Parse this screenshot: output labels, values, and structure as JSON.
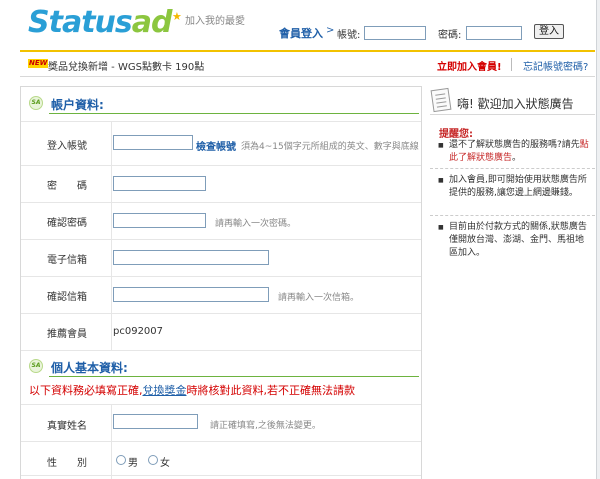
{
  "header": {
    "logo_main": "Status",
    "logo_accent": "ad",
    "favorite": "加入我的最愛",
    "login_title": "會員登入",
    "login_arrow": ">",
    "account_label": "帳號:",
    "password_label": "密碼:",
    "login_button": "登入"
  },
  "news": {
    "badge": "NEW",
    "text": "獎品兌換新增 - WGS點數卡 190點",
    "join_link": "立即加入會員!",
    "forgot_link": "忘記帳號密碼?"
  },
  "account_section": {
    "icon": "SA",
    "title": "帳户資料:",
    "fields": [
      {
        "label": "登入帳號",
        "check_link": "檢查帳號",
        "hint": "須為4~15個字元所組成的英文、數字與底線"
      },
      {
        "label": "密　　碼"
      },
      {
        "label": "確認密碼",
        "hint": "請再輸入一次密碼。"
      },
      {
        "label": "電子信箱"
      },
      {
        "label": "確認信箱",
        "hint": "請再輸入一次信箱。"
      },
      {
        "label": "推薦會員",
        "value": "pc092007"
      }
    ]
  },
  "personal_section": {
    "icon": "SA",
    "title": "個人基本資料:",
    "warning_pre": "以下資料務必填寫正確,",
    "warning_link": "兌換獎金",
    "warning_post": "時將核對此資料,若不正確無法請款",
    "fields": [
      {
        "label": "真實姓名",
        "hint": "請正確填寫,之後無法變更。"
      },
      {
        "label": "性　　別",
        "option_male": "男",
        "option_female": "女"
      }
    ]
  },
  "side": {
    "title": "嗨! 歡迎加入狀態廣告",
    "tips_title": "提醒您:",
    "tip1_pre": "還不了解狀態廣告的服務嗎?請先",
    "tip1_link": "點此了解狀態廣告",
    "tip1_post": "。",
    "tip2": "加入會員,即可開始使用狀態廣告所提供的服務,讓您邊上網邊賺錢。",
    "tip3": "目前由於付款方式的關係,狀態廣告僅開放台灣、澎湖、金門、馬祖地區加入。"
  },
  "colors": {
    "brand_blue": "#2a9fd6",
    "brand_green": "#8cc63f",
    "title_blue": "#1f5fa8",
    "alert_red": "#d40000",
    "accent_yellow": "#f2c200"
  }
}
